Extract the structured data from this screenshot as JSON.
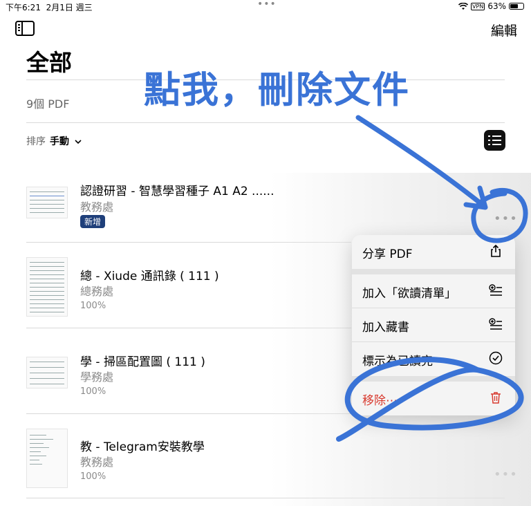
{
  "status": {
    "time": "下午6:21",
    "date": "2月1日 週三",
    "vpn": "VPN",
    "battery": "63%",
    "battery_level": 0.63
  },
  "header": {
    "edit_label": "編輯",
    "title": "全部",
    "count": "9個 PDF",
    "sort_label": "排序",
    "sort_value": "手動"
  },
  "documents": [
    {
      "title": "認證研習 - 智慧學習種子 A1 A2 ......",
      "subtitle": "教務處",
      "badge": "新增"
    },
    {
      "title": "總 - Xiude 通訊錄 ( 111 )",
      "subtitle": "總務處",
      "meta": "100%"
    },
    {
      "title": "學 - 掃區配置圖 ( 111 )",
      "subtitle": "學務處",
      "meta": "100%"
    },
    {
      "title": "教 - Telegram安裝教學",
      "subtitle": "教務處",
      "meta": "100%"
    }
  ],
  "menu": {
    "share": "分享 PDF",
    "add_reading": "加入「欲讀清單」",
    "add_collection": "加入藏書",
    "mark": "標示為已讀完",
    "remove": "移除⋯"
  },
  "annotation": "點我，刪除文件",
  "colors": {
    "accent": "#3a73d6",
    "badge": "#1f3f7a",
    "danger": "#d8392e"
  }
}
